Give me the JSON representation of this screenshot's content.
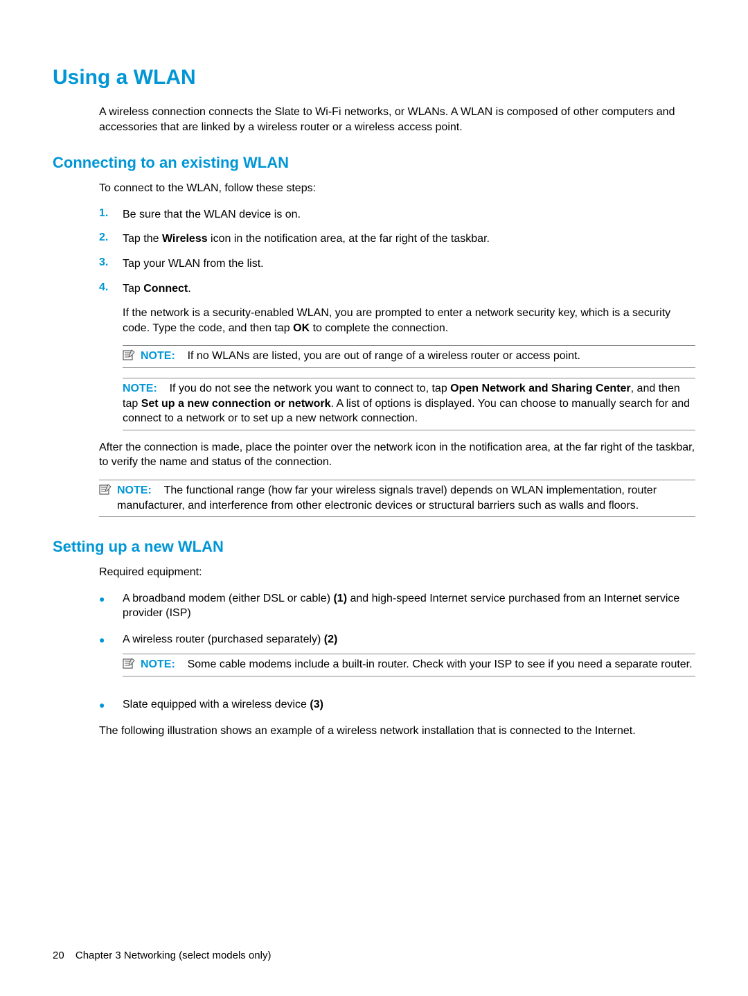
{
  "title": "Using a WLAN",
  "intro": "A wireless connection connects the Slate to Wi-Fi networks, or WLANs. A WLAN is composed of other computers and accessories that are linked by a wireless router or a wireless access point.",
  "section1": {
    "heading": "Connecting to an existing WLAN",
    "intro": "To connect to the WLAN, follow these steps:",
    "steps": {
      "s1": {
        "num": "1.",
        "text": "Be sure that the WLAN device is on."
      },
      "s2": {
        "num": "2.",
        "pre": "Tap the ",
        "bold": "Wireless",
        "post": " icon in the notification area, at the far right of the taskbar."
      },
      "s3": {
        "num": "3.",
        "text": "Tap your WLAN from the list."
      },
      "s4": {
        "num": "4.",
        "pre": "Tap ",
        "bold": "Connect",
        "post": ".",
        "followup_pre": "If the network is a security-enabled WLAN, you are prompted to enter a network security key, which is a security code. Type the code, and then tap ",
        "followup_bold": "OK",
        "followup_post": " to complete the connection."
      }
    },
    "note1": {
      "label": "NOTE:",
      "text": "If no WLANs are listed, you are out of range of a wireless router or access point."
    },
    "note2": {
      "label": "NOTE:",
      "pre": "If you do not see the network you want to connect to, tap ",
      "bold1": "Open Network and Sharing Center",
      "mid": ", and then tap ",
      "bold2": "Set up a new connection or network",
      "post": ". A list of options is displayed. You can choose to manually search for and connect to a network or to set up a new network connection."
    },
    "after": "After the connection is made, place the pointer over the network icon in the notification area, at the far right of the taskbar, to verify the name and status of the connection.",
    "note3": {
      "label": "NOTE:",
      "text": "The functional range (how far your wireless signals travel) depends on WLAN implementation, router manufacturer, and interference from other electronic devices or structural barriers such as walls and floors."
    }
  },
  "section2": {
    "heading": "Setting up a new WLAN",
    "intro": "Required equipment:",
    "bullets": {
      "b1": {
        "pre": "A broadband modem (either DSL or cable) ",
        "bold": "(1)",
        "post": " and high-speed Internet service purchased from an Internet service provider (ISP)"
      },
      "b2": {
        "pre": "A wireless router (purchased separately) ",
        "bold": "(2)"
      },
      "b2note": {
        "label": "NOTE:",
        "text": "Some cable modems include a built-in router. Check with your ISP to see if you need a separate router."
      },
      "b3": {
        "pre": "Slate equipped with a wireless device ",
        "bold": "(3)"
      }
    },
    "after": "The following illustration shows an example of a wireless network installation that is connected to the Internet."
  },
  "footer": {
    "page": "20",
    "chapter": "Chapter 3   Networking (select models only)"
  }
}
